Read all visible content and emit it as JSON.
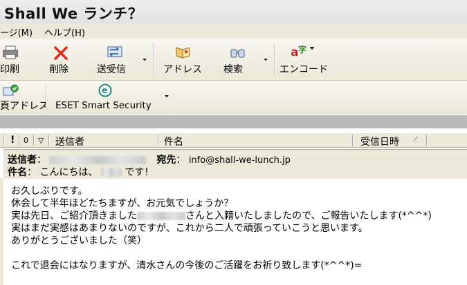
{
  "window": {
    "title": "Shall We ランチ？"
  },
  "menu": {
    "items": [
      "ージ(M)",
      "ヘルプ(H)"
    ]
  },
  "toolbar": {
    "buttons": [
      "印刷",
      "削除",
      "送受信",
      "アドレス",
      "検索",
      "エンコード"
    ]
  },
  "toolbar2": {
    "buttons": [
      "頁アドレス",
      "ESET Smart Security"
    ]
  },
  "message_list": {
    "columns": [
      "!",
      "0",
      "▽",
      "送信者",
      "件名",
      "受信日時"
    ]
  },
  "preview": {
    "from_label": "送信者",
    "to_label": "宛先",
    "to_value": "info@shall-we-lunch.jp",
    "subject_label": "件名",
    "subject_before": "こんにちは、",
    "subject_after": "です！"
  },
  "body": {
    "line1": "お久しぶりです。",
    "line2": "休会して半年ほどたちますが、お元気でしょうか？",
    "line3_before": "実は先日、ご紹介頂きました",
    "line3_after": "さんと入籍いたしましたので、ご報告いたします(*^^*)",
    "line4": "実はまだ実感はあまりないのですが、これから二人で頑張っていこうと思います。",
    "line5": "ありがとうございました（笑）",
    "line6": "これで退会にはなりますが、清水さんの今後のご活躍をお祈り致します(*^^*)="
  }
}
